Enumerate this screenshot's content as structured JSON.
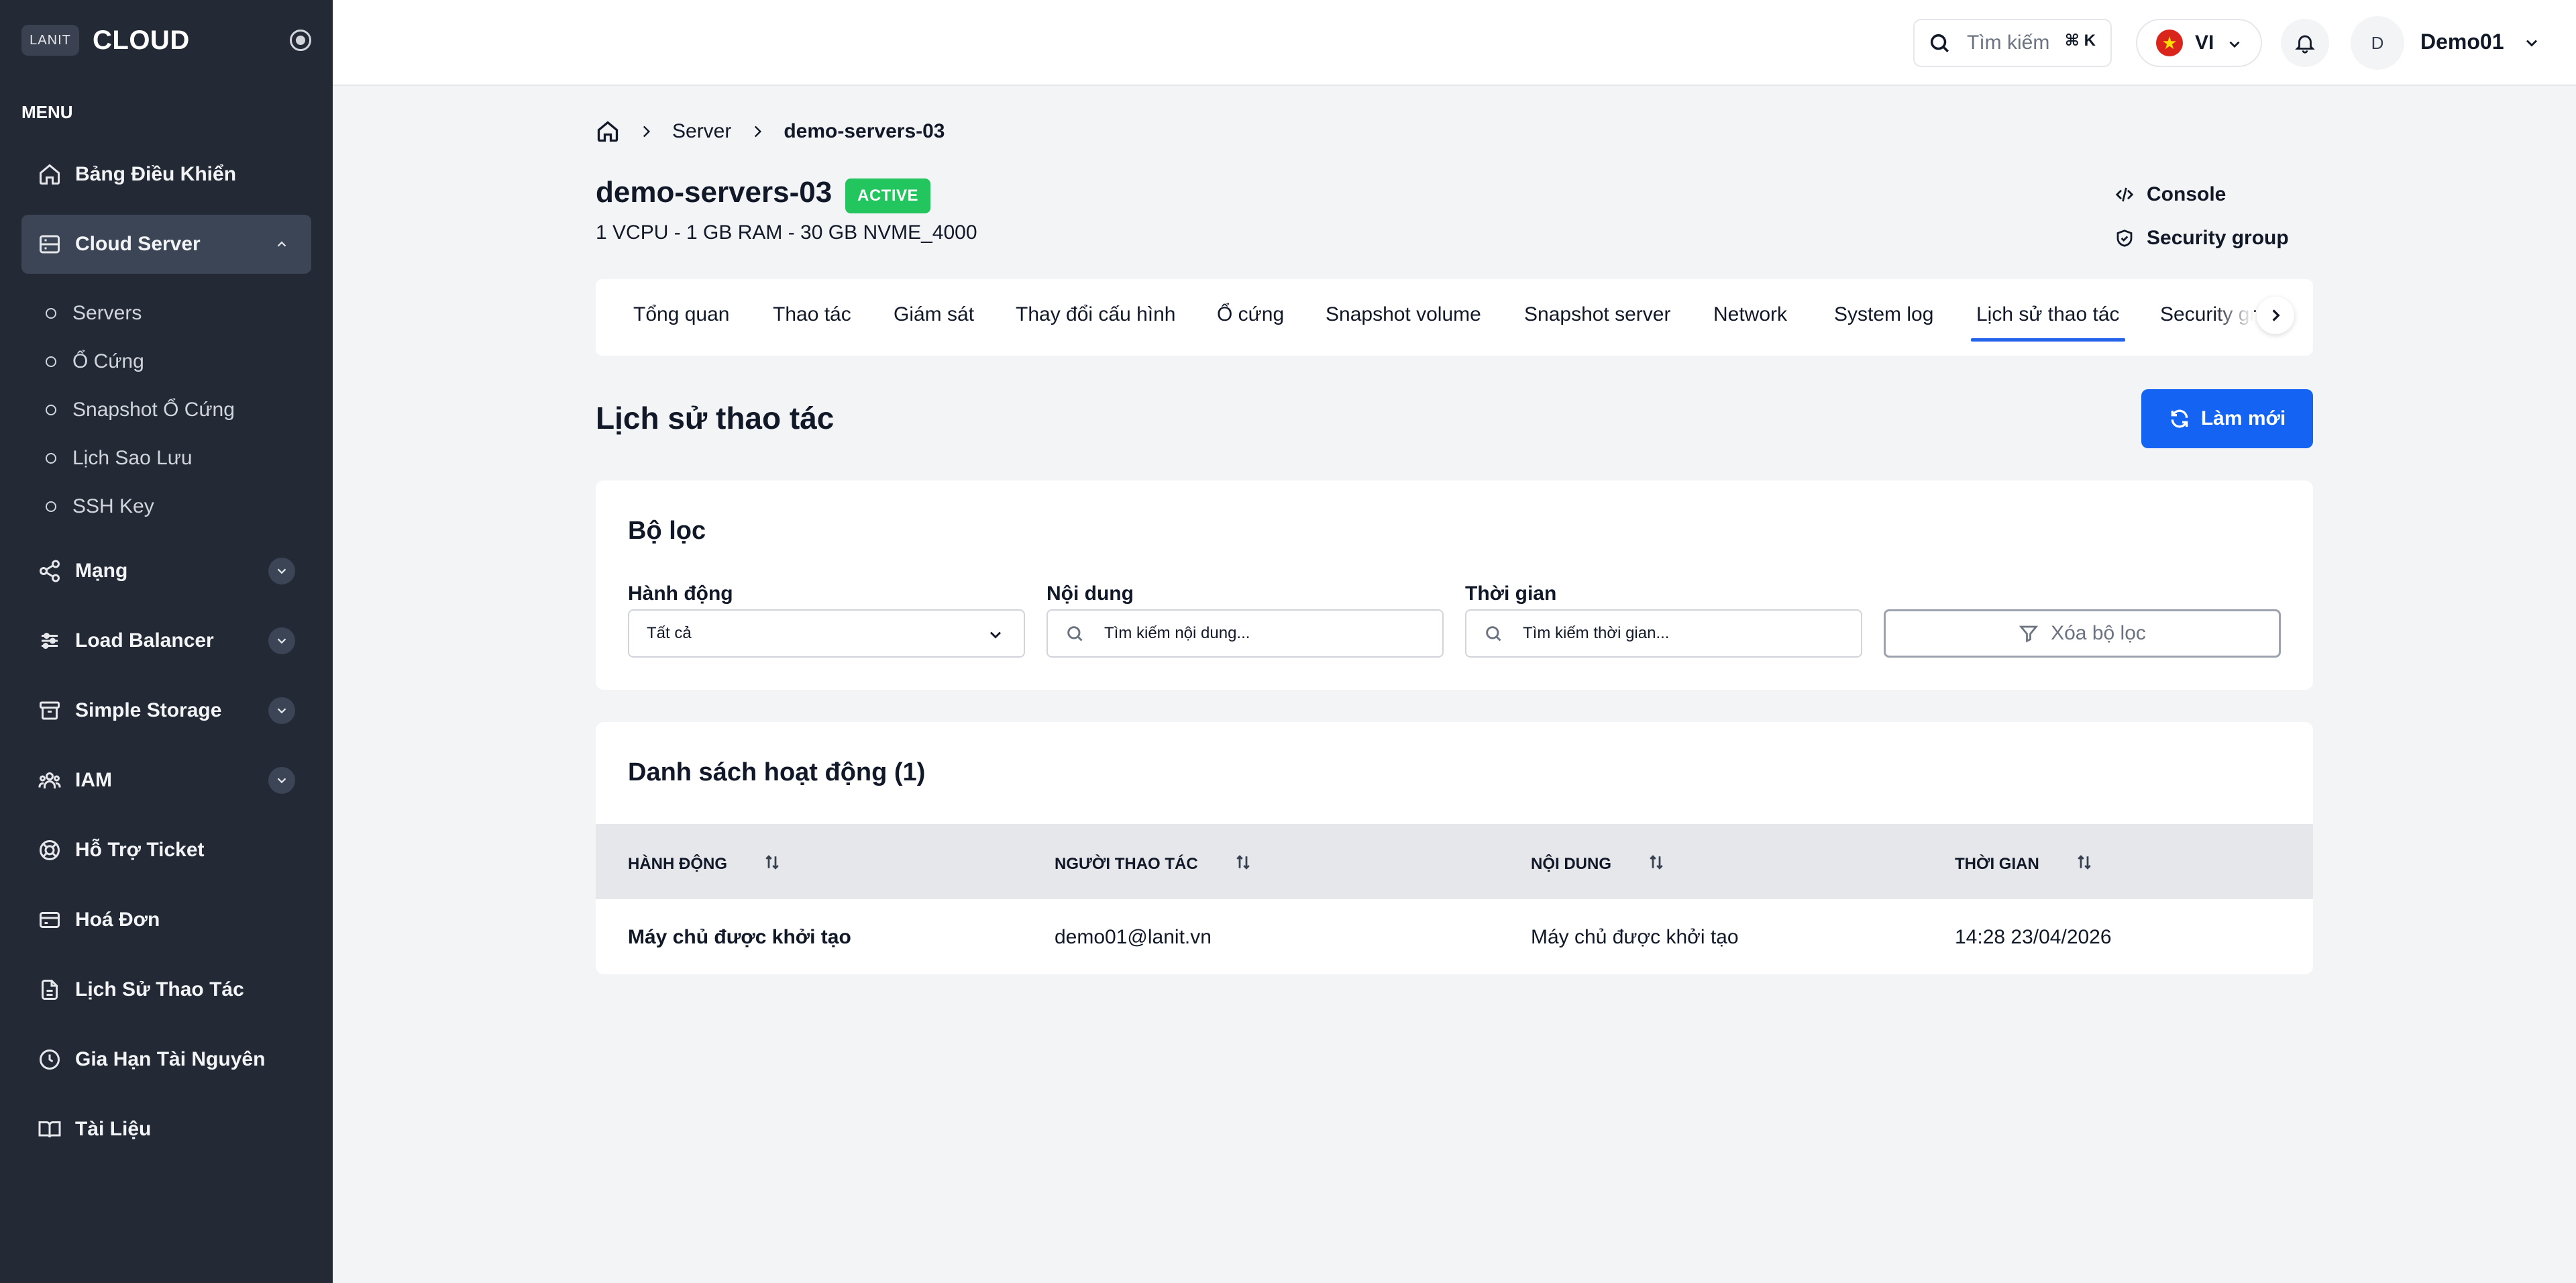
{
  "brand": {
    "logo_text": "LANIT",
    "name": "CLOUD"
  },
  "sidebar": {
    "menu_heading": "MENU",
    "items": [
      {
        "label": "Bảng Điều Khiển",
        "icon": "home-icon"
      },
      {
        "label": "Cloud Server",
        "icon": "server-icon",
        "expanded": true,
        "children": [
          "Servers",
          "Ổ Cứng",
          "Snapshot Ổ Cứng",
          "Lịch Sao Lưu",
          "SSH Key"
        ]
      },
      {
        "label": "Mạng",
        "icon": "share-icon",
        "expandable": true
      },
      {
        "label": "Load Balancer",
        "icon": "sliders-icon",
        "expandable": true
      },
      {
        "label": "Simple Storage",
        "icon": "archive-icon",
        "expandable": true
      },
      {
        "label": "IAM",
        "icon": "users-icon",
        "expandable": true
      },
      {
        "label": "Hỗ Trợ Ticket",
        "icon": "lifebuoy-icon"
      },
      {
        "label": "Hoá Đơn",
        "icon": "credit-card-icon"
      },
      {
        "label": "Lịch Sử Thao Tác",
        "icon": "document-icon"
      },
      {
        "label": "Gia Hạn Tài Nguyên",
        "icon": "clock-icon"
      },
      {
        "label": "Tài Liệu",
        "icon": "book-icon"
      }
    ]
  },
  "topbar": {
    "search_label": "Tìm kiếm",
    "search_shortcut": "⌘ K",
    "language": "VI",
    "avatar_initial": "D",
    "user_name": "Demo01"
  },
  "breadcrumb": {
    "parent": "Server",
    "current": "demo-servers-03"
  },
  "server": {
    "name": "demo-servers-03",
    "status": "ACTIVE",
    "status_color": "#22c55e",
    "spec": "1 VCPU - 1 GB RAM - 30 GB NVME_4000",
    "console_label": "Console",
    "security_group_label": "Security group"
  },
  "tabs": [
    "Tổng quan",
    "Thao tác",
    "Giám sát",
    "Thay đổi cấu hình",
    "Ổ cứng",
    "Snapshot volume",
    "Snapshot server",
    "Network",
    "System log",
    "Lịch sử thao tác",
    "Security group"
  ],
  "active_tab": "Lịch sử thao tác",
  "section": {
    "title": "Lịch sử thao tác",
    "refresh_label": "Làm mới",
    "accent": "#1463f3"
  },
  "filters": {
    "title": "Bộ lọc",
    "action_label": "Hành động",
    "action_value": "Tất cả",
    "content_label": "Nội dung",
    "content_placeholder": "Tìm kiếm nội dung...",
    "time_label": "Thời gian",
    "time_placeholder": "Tìm kiếm thời gian...",
    "clear_label": "Xóa bộ lọc"
  },
  "activity": {
    "title": "Danh sách hoạt động (1)",
    "columns": [
      "HÀNH ĐỘNG",
      "NGƯỜI THAO TÁC",
      "NỘI DUNG",
      "THỜI GIAN"
    ],
    "rows": [
      [
        "Máy chủ được khởi tạo",
        "demo01@lanit.vn",
        "Máy chủ được khởi tạo",
        "14:28 23/04/2026"
      ]
    ]
  }
}
